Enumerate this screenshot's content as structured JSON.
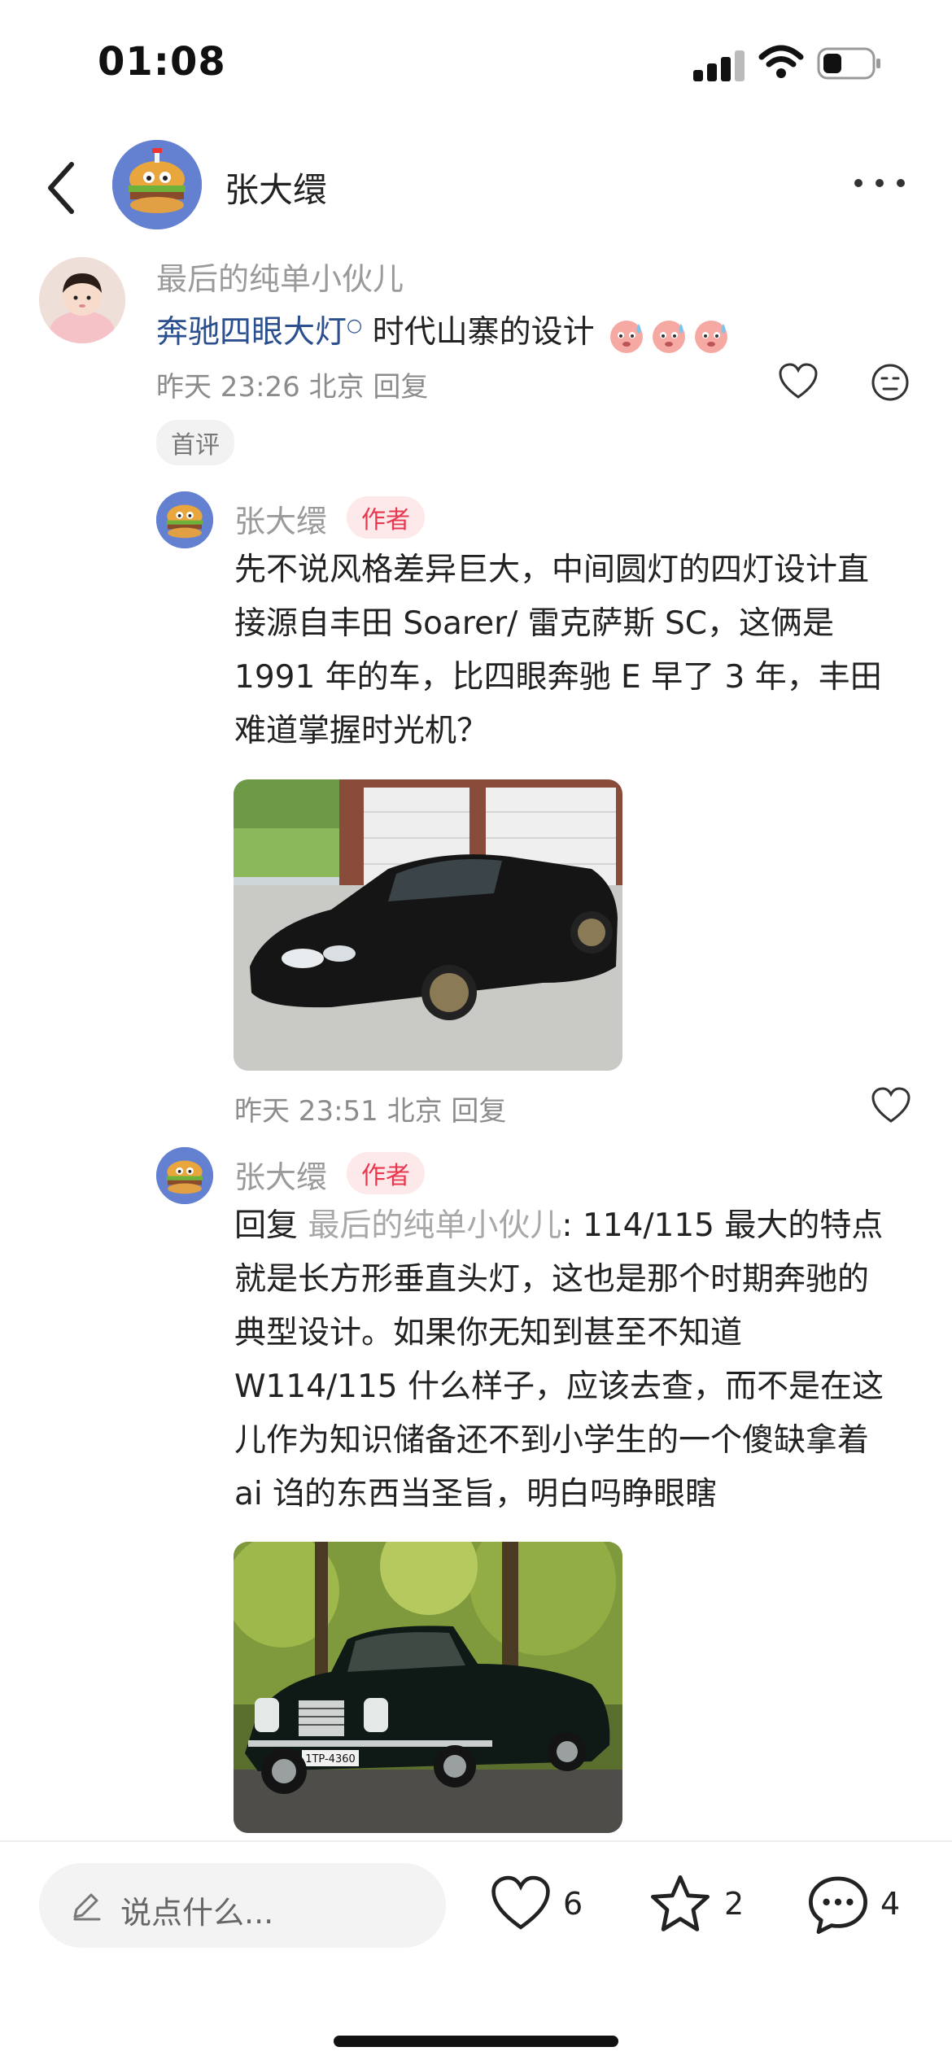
{
  "status_bar": {
    "time": "01:08"
  },
  "header": {
    "title": "张大缳"
  },
  "top_comment": {
    "username": "最后的纯单小伙儿",
    "link_text": "奔驰四眼大灯",
    "text": " 时代山寨的设计",
    "meta": "昨天 23:26 北京 回复",
    "badge": "首评"
  },
  "replies": [
    {
      "username": "张大缳",
      "author_tag": "作者",
      "lines": [
        "先不说风格差异巨大，中间圆灯的四灯设计直",
        "接源自丰田 Soarer/ 雷克萨斯 SC，这俩是",
        "1991 年的车，比四眼奔驰 E 早了 3 年，丰田",
        "难道掌握时光机？"
      ],
      "meta": "昨天 23:51 北京 回复"
    },
    {
      "username": "张大缳",
      "author_tag": "作者",
      "reply_prefix": "回复 ",
      "reply_to": "最后的纯单小伙儿",
      "line1_rest": ": 114/115 最大的特点",
      "lines": [
        "就是长方形垂直头灯，这也是那个时期奔驰的",
        "典型设计。如果你无知到甚至不知道",
        " W114/115 什么样子，应该去查，而不是在这",
        "儿作为知识储备还不到小学生的一个傻缺拿着",
        "ai 诌的东西当圣旨，明白吗睁眼瞎"
      ],
      "plate": "1TP-4360"
    }
  ],
  "bottom_bar": {
    "placeholder": "说点什么...",
    "likes": "6",
    "stars": "2",
    "comments": "4"
  }
}
